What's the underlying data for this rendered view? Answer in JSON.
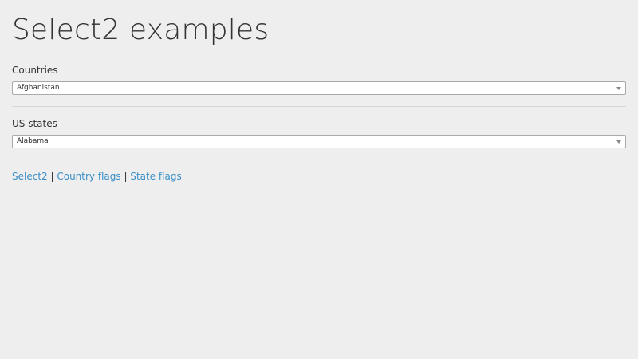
{
  "page": {
    "title": "Select2 examples"
  },
  "countries": {
    "label": "Countries",
    "selected": "Afghanistan"
  },
  "states": {
    "label": "US states",
    "selected": "Alabama"
  },
  "links": {
    "select2": "Select2",
    "country_flags": "Country flags",
    "state_flags": "State flags",
    "separator": "|"
  },
  "colors": {
    "background": "#eeeeee",
    "link": "#3a8fc7",
    "border": "#aaaaaa"
  },
  "icons": {
    "dropdown": "chevron-down-icon"
  }
}
